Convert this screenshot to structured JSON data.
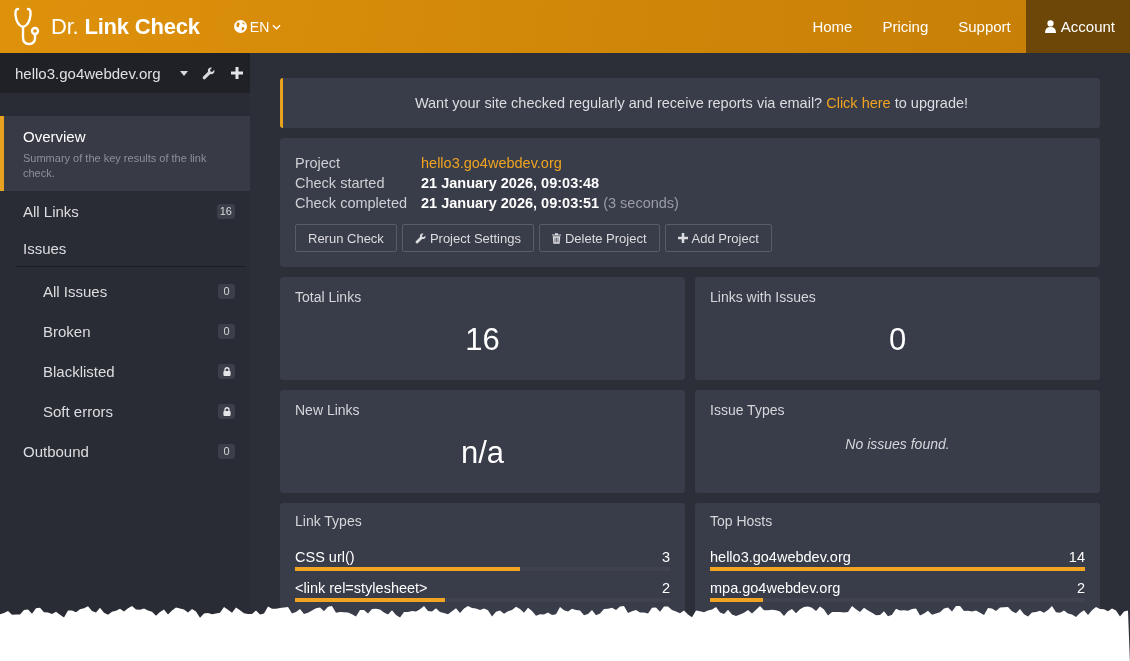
{
  "header": {
    "logo": "Dr. **Link Check**",
    "language": "EN",
    "nav": [
      {
        "label": "Home",
        "kind": "link"
      },
      {
        "label": "Pricing",
        "kind": "link"
      },
      {
        "label": "Support",
        "kind": "link"
      },
      {
        "label": "Account",
        "kind": "account"
      }
    ]
  },
  "sidebar": {
    "project": "hello3.go4webdev.org",
    "items": [
      {
        "label": "Overview",
        "description": "Summary of the key results of the link check.",
        "kind": "page",
        "selected": true
      },
      {
        "label": "All Links",
        "badge": "16",
        "locked": false,
        "kind": "page",
        "selected": false
      },
      {
        "label": "Issues",
        "kind": "group",
        "children": [
          {
            "label": "All Issues",
            "badge": "0",
            "locked": false,
            "selected": false
          },
          {
            "label": "Broken",
            "badge": "0",
            "locked": false,
            "selected": false
          },
          {
            "label": "Blacklisted",
            "locked": true,
            "selected": false
          },
          {
            "label": "Soft errors",
            "locked": true,
            "selected": false
          }
        ]
      },
      {
        "label": "Outbound",
        "badge": "0",
        "locked": false,
        "kind": "page",
        "selected": false
      }
    ]
  },
  "banner": {
    "text_before": "Want your site checked regularly and receive reports via email?",
    "link": "Click here",
    "text_after": "to upgrade!"
  },
  "project": {
    "fields": [
      {
        "label": "Project",
        "value": "hello3.go4webdev.org",
        "kind": "link"
      },
      {
        "label": "Check started",
        "value": "21 January 2026, 09:03:48",
        "kind": "text"
      },
      {
        "label": "Check completed",
        "value": "21 January 2026, 09:03:51",
        "note": "(3 seconds)",
        "kind": "text"
      }
    ],
    "buttons": [
      {
        "label": "Rerun Check",
        "kind": "rerun"
      },
      {
        "label": "Project Settings",
        "kind": "settings"
      },
      {
        "label": "Delete Project",
        "kind": "delete"
      },
      {
        "label": "Add Project",
        "kind": "add"
      }
    ]
  },
  "stats": [
    {
      "title": "Total Links",
      "value": "16",
      "kind": "number"
    },
    {
      "title": "Links with Issues",
      "value": "0",
      "kind": "number"
    },
    {
      "title": "New Links",
      "value": "n/a",
      "kind": "number"
    },
    {
      "title": "Issue Types",
      "message": "No issues found.",
      "kind": "message"
    }
  ],
  "breakdowns": [
    {
      "title": "Link Types",
      "rows": [
        {
          "label": "CSS url()",
          "count": "3",
          "level": 0.6
        },
        {
          "label": "<link rel=stylesheet>",
          "count": "2",
          "level": 0.4
        }
      ]
    },
    {
      "title": "Top Hosts",
      "rows": [
        {
          "label": "hello3.go4webdev.org",
          "count": "14",
          "level": 1
        },
        {
          "label": "mpa.go4webdev.org",
          "count": "2",
          "level": 0.14
        }
      ]
    }
  ]
}
